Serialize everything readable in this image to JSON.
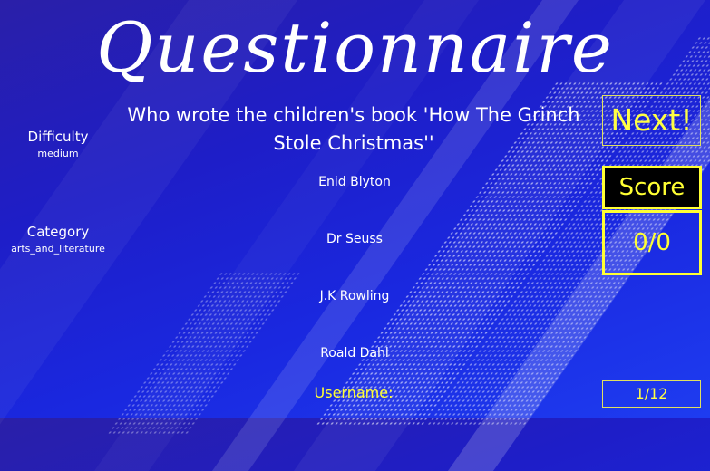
{
  "app": {
    "title": "Questionnaire"
  },
  "question": {
    "text": "Who wrote the children's book 'How The Grinch Stole Christmas''"
  },
  "answers": [
    "Enid Blyton",
    "Dr Seuss",
    "J.K Rowling",
    "Roald Dahl"
  ],
  "difficulty": {
    "label": "Difficulty",
    "value": "medium"
  },
  "category": {
    "label": "Category",
    "value": "arts_and_literature"
  },
  "controls": {
    "next_label": "Next!"
  },
  "score": {
    "label": "Score",
    "value": "0/0"
  },
  "user": {
    "username_label": "Username:"
  },
  "progress": {
    "text": "1/12"
  },
  "colors": {
    "accent": "#ffff33",
    "background": "#1e1ec8"
  }
}
